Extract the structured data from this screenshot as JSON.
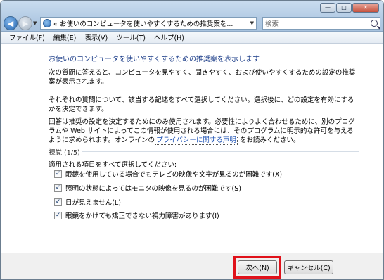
{
  "window": {
    "address_text": "« お使いのコンピュータを使いやすくするための推奨案を...",
    "search_placeholder": "検索"
  },
  "menu": [
    "ファイル(F)",
    "編集(E)",
    "表示(V)",
    "ツール(T)",
    "ヘルプ(H)"
  ],
  "content": {
    "heading": "お使いのコンピュータを使いやすくするための推奨案を表示します",
    "para1": "次の質問に答えると、コンピュータを見やすく、聞きやすく、および使いやすくするための設定の推奨案が表示されます。",
    "para2": "それぞれの質問について、該当する記述をすべて選択してください。選択後に、どの設定を有効にするかを決定できます。",
    "para3_before": "回答は推奨の設定を決定するためにのみ使用されます。必要性によりよく合わせるために、別のプログラムや Web サイトによってこの情報が使用される場合には、そのプログラムに明示的な許可を与えるように求められます。オンラインの",
    "privacy_link": "プライバシーに関する声明",
    "para3_after": "をお読みください。",
    "section_title": "視覚 (1/5)",
    "instruction": "適用される項目をすべて選択してください:",
    "checkboxes": [
      {
        "label": "眼鏡を使用している場合でもテレビの映像や文字が見るのが困難です(X)",
        "checked": true
      },
      {
        "label": "照明の状態によってはモニタの映像を見るのが困難です(S)",
        "checked": true
      },
      {
        "label": "目が見えません(L)",
        "checked": true
      },
      {
        "label": "眼鏡をかけても矯正できない視力障害があります(I)",
        "checked": true
      }
    ]
  },
  "footer": {
    "next_label": "次へ(N)",
    "cancel_label": "キャンセル(C)"
  },
  "colors": {
    "heading": "#1e3f8a",
    "link": "#1a4fb3",
    "highlight": "#e0111a"
  }
}
